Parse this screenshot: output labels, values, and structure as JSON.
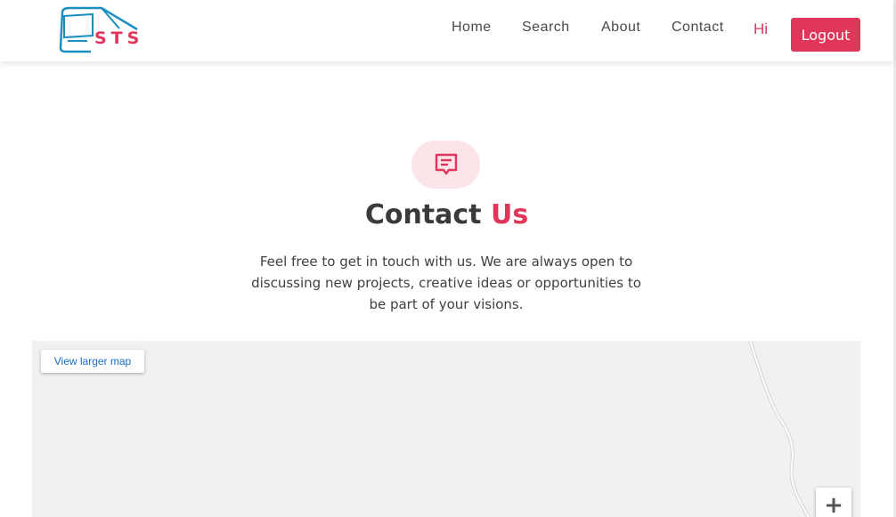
{
  "header": {
    "logo_text": "STS",
    "nav": [
      "Home",
      "Search",
      "About",
      "Contact"
    ],
    "greeting": "Hi",
    "logout_label": "Logout"
  },
  "contact": {
    "icon": "message-square-icon",
    "title_main": "Contact",
    "title_accent": "Us",
    "description": "Feel free to get in touch with us. We are always open to discussing new projects, creative ideas or opportunities to be part of your visions."
  },
  "map": {
    "view_larger_label": "View larger map",
    "zoom_in_label": "+"
  },
  "colors": {
    "accent": "#e0365a",
    "logo_blue": "#1a8fc0",
    "map_bg": "#f1f1f3"
  }
}
